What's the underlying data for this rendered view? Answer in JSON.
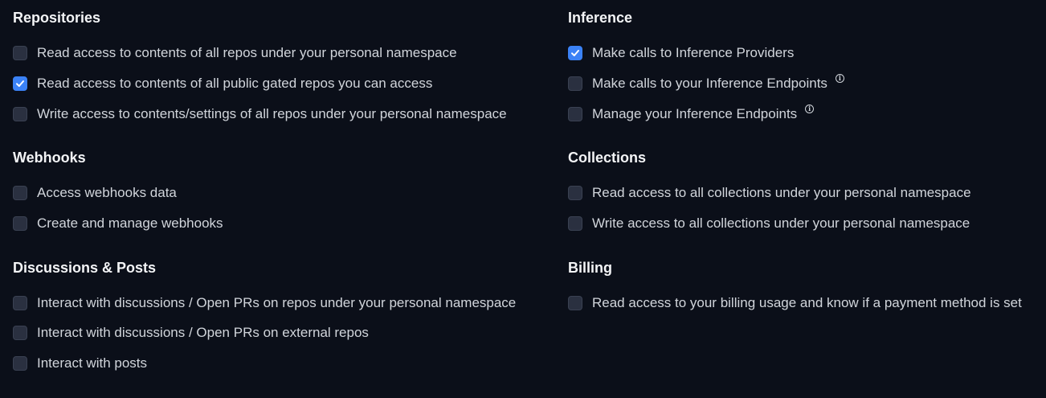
{
  "sections": {
    "repositories": {
      "title": "Repositories",
      "options": [
        {
          "label": "Read access to contents of all repos under your personal namespace",
          "checked": false
        },
        {
          "label": "Read access to contents of all public gated repos you can access",
          "checked": true
        },
        {
          "label": "Write access to contents/settings of all repos under your personal namespace",
          "checked": false
        }
      ]
    },
    "webhooks": {
      "title": "Webhooks",
      "options": [
        {
          "label": "Access webhooks data",
          "checked": false
        },
        {
          "label": "Create and manage webhooks",
          "checked": false
        }
      ]
    },
    "discussions": {
      "title": "Discussions & Posts",
      "options": [
        {
          "label": "Interact with discussions / Open PRs on repos under your personal namespace",
          "checked": false
        },
        {
          "label": "Interact with discussions / Open PRs on external repos",
          "checked": false
        },
        {
          "label": "Interact with posts",
          "checked": false
        }
      ]
    },
    "inference": {
      "title": "Inference",
      "options": [
        {
          "label": "Make calls to Inference Providers",
          "checked": true,
          "info": false
        },
        {
          "label": "Make calls to your Inference Endpoints",
          "checked": false,
          "info": true
        },
        {
          "label": "Manage your Inference Endpoints",
          "checked": false,
          "info": true
        }
      ]
    },
    "collections": {
      "title": "Collections",
      "options": [
        {
          "label": "Read access to all collections under your personal namespace",
          "checked": false
        },
        {
          "label": "Write access to all collections under your personal namespace",
          "checked": false
        }
      ]
    },
    "billing": {
      "title": "Billing",
      "options": [
        {
          "label": "Read access to your billing usage and know if a payment method is set",
          "checked": false
        }
      ]
    }
  },
  "icons": {
    "checkmark": "checkmark-icon",
    "info": "info-icon",
    "info_glyph": "i"
  },
  "colors": {
    "background": "#0b0f19",
    "checkbox_checked": "#3b82f6",
    "checkbox_unchecked": "#2a3040"
  }
}
